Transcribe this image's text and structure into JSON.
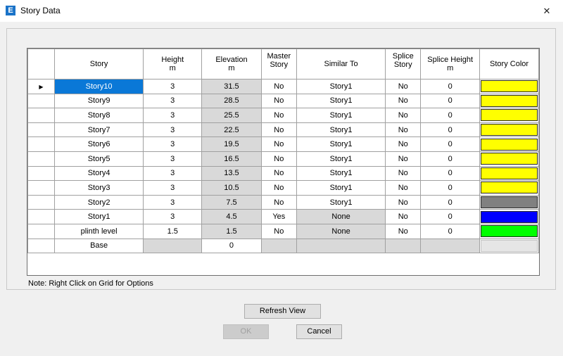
{
  "window": {
    "title": "Story Data",
    "app_icon_letter": "E",
    "close_glyph": "✕"
  },
  "grid": {
    "headers": {
      "story": "Story",
      "height": [
        "Height",
        "m"
      ],
      "elevation": [
        "Elevation",
        "m"
      ],
      "master": [
        "Master",
        "Story"
      ],
      "similar": "Similar To",
      "splice": [
        "Splice",
        "Story"
      ],
      "splice_height": [
        "Splice Height",
        "m"
      ],
      "color": "Story Color"
    },
    "current_row_marker": "▶",
    "rows": [
      {
        "story": "Story10",
        "height": "3",
        "elevation": "31.5",
        "master": "No",
        "similar": "Story1",
        "splice": "No",
        "splice_height": "0",
        "color": "#ffff00"
      },
      {
        "story": "Story9",
        "height": "3",
        "elevation": "28.5",
        "master": "No",
        "similar": "Story1",
        "splice": "No",
        "splice_height": "0",
        "color": "#ffff00"
      },
      {
        "story": "Story8",
        "height": "3",
        "elevation": "25.5",
        "master": "No",
        "similar": "Story1",
        "splice": "No",
        "splice_height": "0",
        "color": "#ffff00"
      },
      {
        "story": "Story7",
        "height": "3",
        "elevation": "22.5",
        "master": "No",
        "similar": "Story1",
        "splice": "No",
        "splice_height": "0",
        "color": "#ffff00"
      },
      {
        "story": "Story6",
        "height": "3",
        "elevation": "19.5",
        "master": "No",
        "similar": "Story1",
        "splice": "No",
        "splice_height": "0",
        "color": "#ffff00"
      },
      {
        "story": "Story5",
        "height": "3",
        "elevation": "16.5",
        "master": "No",
        "similar": "Story1",
        "splice": "No",
        "splice_height": "0",
        "color": "#ffff00"
      },
      {
        "story": "Story4",
        "height": "3",
        "elevation": "13.5",
        "master": "No",
        "similar": "Story1",
        "splice": "No",
        "splice_height": "0",
        "color": "#ffff00"
      },
      {
        "story": "Story3",
        "height": "3",
        "elevation": "10.5",
        "master": "No",
        "similar": "Story1",
        "splice": "No",
        "splice_height": "0",
        "color": "#ffff00"
      },
      {
        "story": "Story2",
        "height": "3",
        "elevation": "7.5",
        "master": "No",
        "similar": "Story1",
        "splice": "No",
        "splice_height": "0",
        "color": "#808080"
      },
      {
        "story": "Story1",
        "height": "3",
        "elevation": "4.5",
        "master": "Yes",
        "similar": "None",
        "splice": "No",
        "splice_height": "0",
        "color": "#0000ff"
      },
      {
        "story": "plinth level",
        "height": "1.5",
        "elevation": "1.5",
        "master": "No",
        "similar": "None",
        "splice": "No",
        "splice_height": "0",
        "color": "#00ff00"
      },
      {
        "story": "Base",
        "height": "",
        "elevation": "0",
        "master": "",
        "similar": "",
        "splice": "",
        "splice_height": "",
        "color": ""
      }
    ]
  },
  "note": "Note:  Right Click on Grid for Options",
  "buttons": {
    "refresh": "Refresh View",
    "ok": "OK",
    "cancel": "Cancel"
  }
}
